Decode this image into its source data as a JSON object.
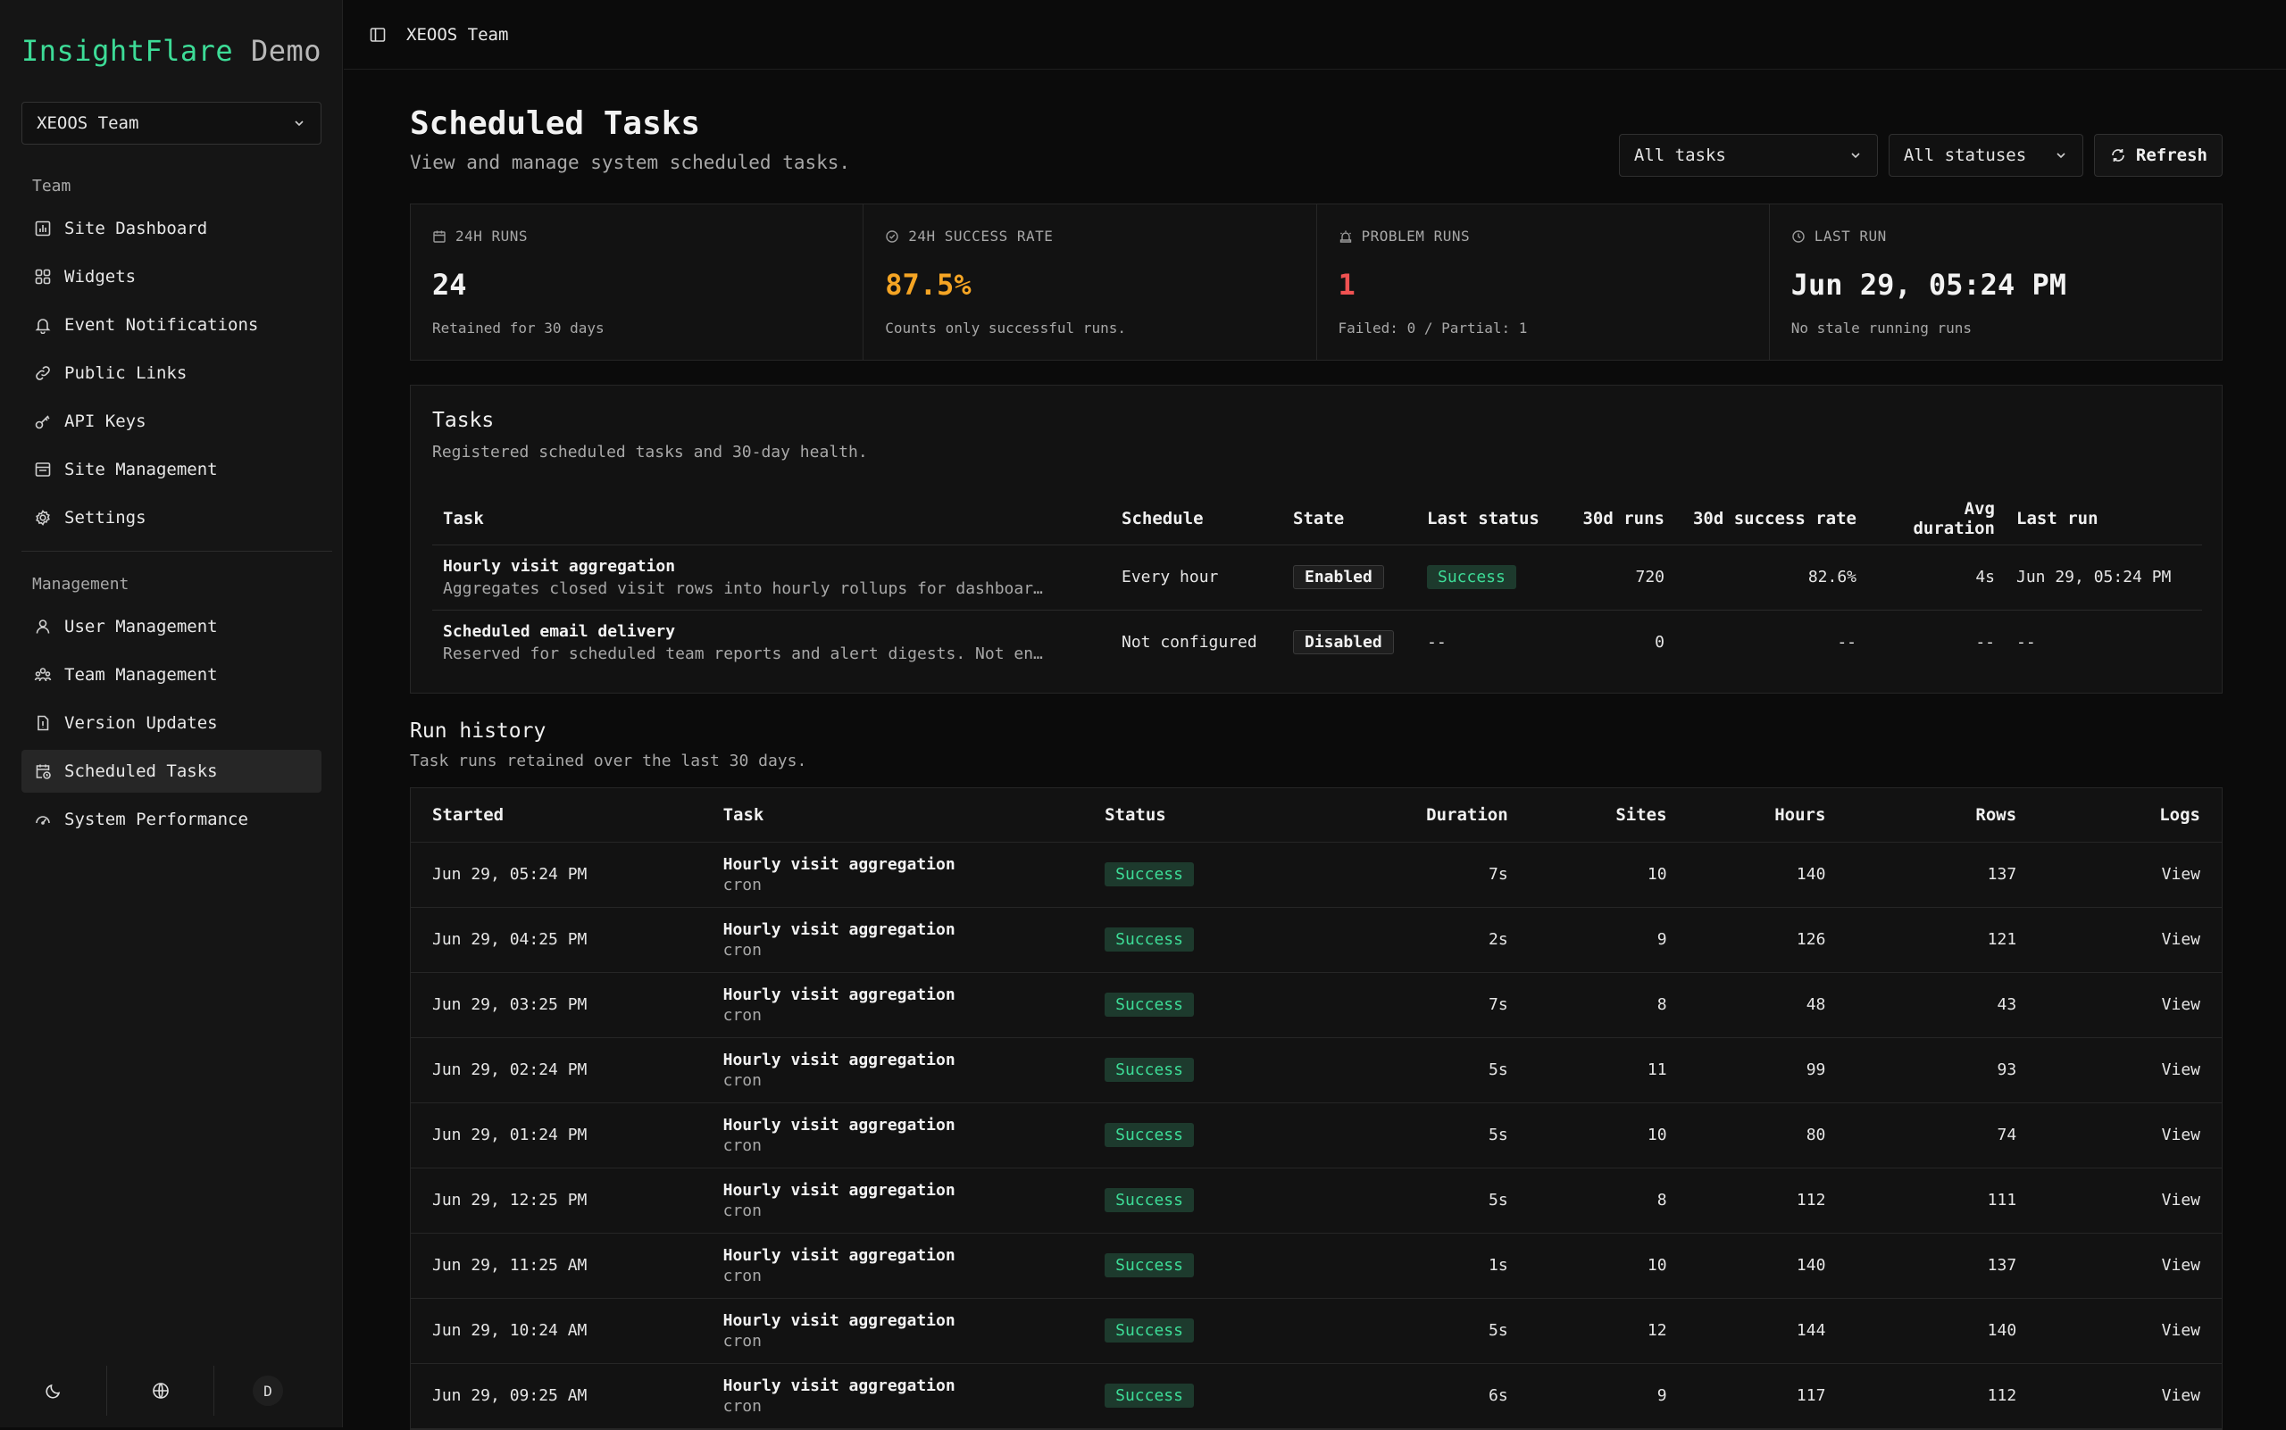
{
  "brand": {
    "name": "InsightFlare",
    "suffix": "Demo"
  },
  "team_selector": {
    "value": "XEOOS Team"
  },
  "sidebar": {
    "team_label": "Team",
    "team_items": [
      {
        "label": "Site Dashboard",
        "icon": "chart-icon"
      },
      {
        "label": "Widgets",
        "icon": "widgets-icon"
      },
      {
        "label": "Event Notifications",
        "icon": "bell-icon"
      },
      {
        "label": "Public Links",
        "icon": "link-icon"
      },
      {
        "label": "API Keys",
        "icon": "key-icon"
      },
      {
        "label": "Site Management",
        "icon": "site-icon"
      },
      {
        "label": "Settings",
        "icon": "gear-icon"
      }
    ],
    "management_label": "Management",
    "management_items": [
      {
        "label": "User Management",
        "icon": "user-icon"
      },
      {
        "label": "Team Management",
        "icon": "team-icon"
      },
      {
        "label": "Version Updates",
        "icon": "version-icon"
      },
      {
        "label": "Scheduled Tasks",
        "icon": "calendar-clock-icon",
        "active": true
      },
      {
        "label": "System Performance",
        "icon": "gauge-icon"
      }
    ],
    "avatar_initial": "D"
  },
  "topbar": {
    "title": "XEOOS Team"
  },
  "page": {
    "title": "Scheduled Tasks",
    "subtitle": "View and manage system scheduled tasks.",
    "filters": {
      "task": "All tasks",
      "status": "All statuses",
      "refresh_label": "Refresh"
    }
  },
  "stats": [
    {
      "label": "24H RUNS",
      "value": "24",
      "note": "Retained for 30 days",
      "color": "#f2f2f2"
    },
    {
      "label": "24H SUCCESS RATE",
      "value": "87.5%",
      "note": "Counts only successful runs.",
      "color": "#f5a524"
    },
    {
      "label": "PROBLEM RUNS",
      "value": "1",
      "note": "Failed: 0 / Partial: 1",
      "color": "#f05252"
    },
    {
      "label": "LAST RUN",
      "value": "Jun 29, 05:24 PM",
      "note": "No stale running runs",
      "color": "#f2f2f2"
    }
  ],
  "tasks": {
    "title": "Tasks",
    "subtitle": "Registered scheduled tasks and 30-day health.",
    "columns": [
      "Task",
      "Schedule",
      "State",
      "Last status",
      "30d runs",
      "30d success rate",
      "Avg duration",
      "Last run"
    ],
    "rows": [
      {
        "name": "Hourly visit aggregation",
        "desc": "Aggregates closed visit rows into hourly rollups for dashboar…",
        "schedule": "Every hour",
        "state": "Enabled",
        "last_status": "Success",
        "runs": "720",
        "rate": "82.6%",
        "avg": "4s",
        "last_run": "Jun 29, 05:24 PM"
      },
      {
        "name": "Scheduled email delivery",
        "desc": "Reserved for scheduled team reports and alert digests. Not en…",
        "schedule": "Not configured",
        "state": "Disabled",
        "last_status": "--",
        "runs": "0",
        "rate": "--",
        "avg": "--",
        "last_run": "--"
      }
    ]
  },
  "run_history": {
    "title": "Run history",
    "subtitle": "Task runs retained over the last 30 days.",
    "columns": [
      "Started",
      "Task",
      "Status",
      "Duration",
      "Sites",
      "Hours",
      "Rows",
      "Logs"
    ],
    "rows": [
      {
        "started": "Jun 29, 05:24 PM",
        "task": "Hourly visit aggregation",
        "source": "cron",
        "status": "Success",
        "duration": "7s",
        "sites": "10",
        "hours": "140",
        "rows": "137",
        "logs": "View"
      },
      {
        "started": "Jun 29, 04:25 PM",
        "task": "Hourly visit aggregation",
        "source": "cron",
        "status": "Success",
        "duration": "2s",
        "sites": "9",
        "hours": "126",
        "rows": "121",
        "logs": "View"
      },
      {
        "started": "Jun 29, 03:25 PM",
        "task": "Hourly visit aggregation",
        "source": "cron",
        "status": "Success",
        "duration": "7s",
        "sites": "8",
        "hours": "48",
        "rows": "43",
        "logs": "View"
      },
      {
        "started": "Jun 29, 02:24 PM",
        "task": "Hourly visit aggregation",
        "source": "cron",
        "status": "Success",
        "duration": "5s",
        "sites": "11",
        "hours": "99",
        "rows": "93",
        "logs": "View"
      },
      {
        "started": "Jun 29, 01:24 PM",
        "task": "Hourly visit aggregation",
        "source": "cron",
        "status": "Success",
        "duration": "5s",
        "sites": "10",
        "hours": "80",
        "rows": "74",
        "logs": "View"
      },
      {
        "started": "Jun 29, 12:25 PM",
        "task": "Hourly visit aggregation",
        "source": "cron",
        "status": "Success",
        "duration": "5s",
        "sites": "8",
        "hours": "112",
        "rows": "111",
        "logs": "View"
      },
      {
        "started": "Jun 29, 11:25 AM",
        "task": "Hourly visit aggregation",
        "source": "cron",
        "status": "Success",
        "duration": "1s",
        "sites": "10",
        "hours": "140",
        "rows": "137",
        "logs": "View"
      },
      {
        "started": "Jun 29, 10:24 AM",
        "task": "Hourly visit aggregation",
        "source": "cron",
        "status": "Success",
        "duration": "5s",
        "sites": "12",
        "hours": "144",
        "rows": "140",
        "logs": "View"
      },
      {
        "started": "Jun 29, 09:25 AM",
        "task": "Hourly visit aggregation",
        "source": "cron",
        "status": "Success",
        "duration": "6s",
        "sites": "9",
        "hours": "117",
        "rows": "112",
        "logs": "View"
      }
    ]
  }
}
